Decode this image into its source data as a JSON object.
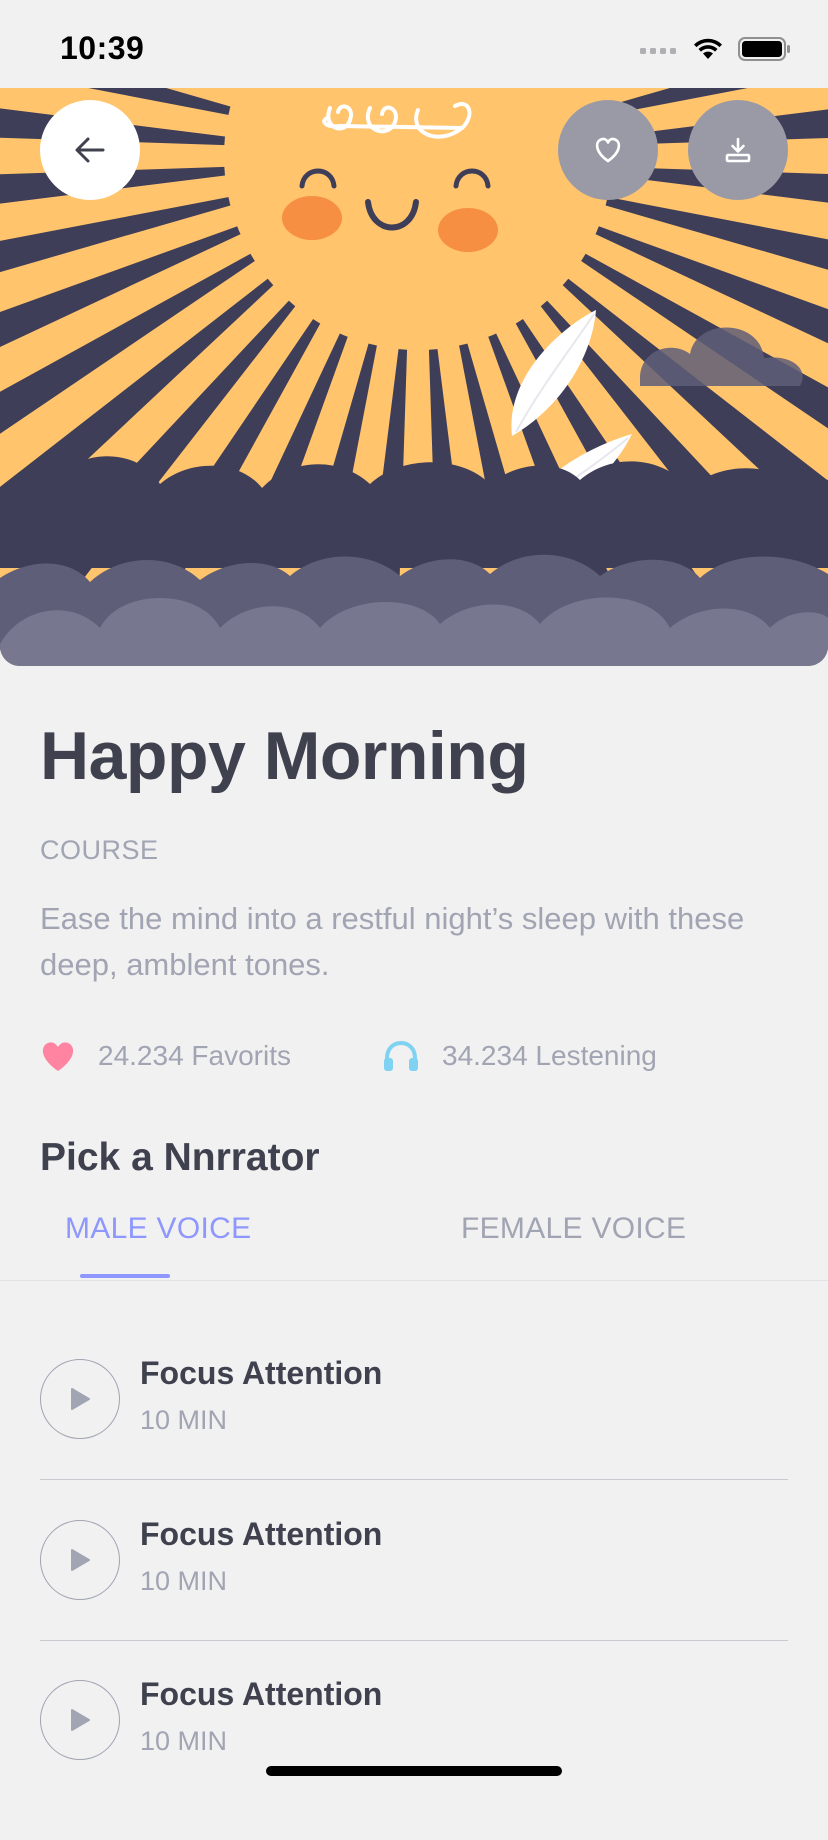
{
  "status_bar": {
    "time": "10:39"
  },
  "hero": {
    "back_icon": "arrow-left-icon",
    "favorite_icon": "heart-outline-icon",
    "download_icon": "download-icon"
  },
  "course": {
    "title": "Happy Morning",
    "category": "COURSE",
    "description": "Ease the mind into a restful night’s sleep with these deep, amblent tones."
  },
  "stats": {
    "favorites": "24.234 Favorits",
    "listening": "34.234 Lestening"
  },
  "narrator": {
    "section_title": "Pick a Nnrrator",
    "tabs": [
      {
        "label": "MALE VOICE",
        "active": true
      },
      {
        "label": "FEMALE VOICE",
        "active": false
      }
    ]
  },
  "tracks": [
    {
      "title": "Focus Attention",
      "duration": "10 MIN"
    },
    {
      "title": "Focus Attention",
      "duration": "10 MIN"
    },
    {
      "title": "Focus Attention",
      "duration": "10 MIN"
    }
  ],
  "colors": {
    "accent": "#8e97fd",
    "heart": "#ff84a2",
    "headphones": "#7fd2f2",
    "text_dark": "#3f414e",
    "text_muted": "#a1a4b2",
    "sun": "#ffc46c",
    "night": "#3f3e59"
  }
}
